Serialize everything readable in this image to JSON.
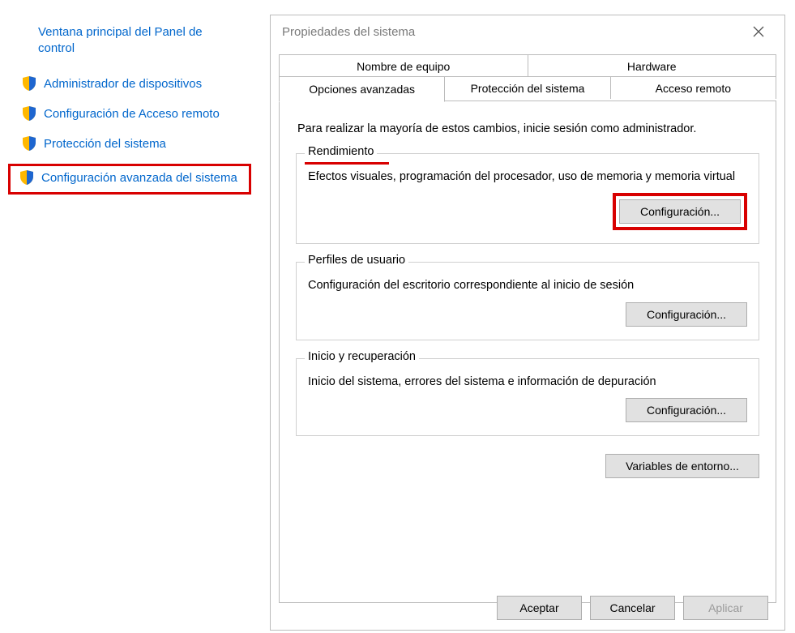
{
  "sidebar": {
    "home": "Ventana principal del Panel de control",
    "items": [
      {
        "label": "Administrador de dispositivos"
      },
      {
        "label": "Configuración de Acceso remoto"
      },
      {
        "label": "Protección del sistema"
      },
      {
        "label": "Configuración avanzada del sistema"
      }
    ]
  },
  "dialog": {
    "title": "Propiedades del sistema",
    "tabs_row1": [
      {
        "label": "Nombre de equipo"
      },
      {
        "label": "Hardware"
      }
    ],
    "tabs_row2": [
      {
        "label": "Opciones avanzadas"
      },
      {
        "label": "Protección del sistema"
      },
      {
        "label": "Acceso remoto"
      }
    ],
    "intro": "Para realizar la mayoría de estos cambios, inicie sesión como administrador.",
    "groups": {
      "performance": {
        "legend": "Rendimiento",
        "desc": "Efectos visuales, programación del procesador, uso de memoria y memoria virtual",
        "button": "Configuración..."
      },
      "profiles": {
        "legend": "Perfiles de usuario",
        "desc": "Configuración del escritorio correspondiente al inicio de sesión",
        "button": "Configuración..."
      },
      "startup": {
        "legend": "Inicio y recuperación",
        "desc": "Inicio del sistema, errores del sistema e información de depuración",
        "button": "Configuración..."
      }
    },
    "env_button": "Variables de entorno...",
    "ok": "Aceptar",
    "cancel": "Cancelar",
    "apply": "Aplicar"
  }
}
